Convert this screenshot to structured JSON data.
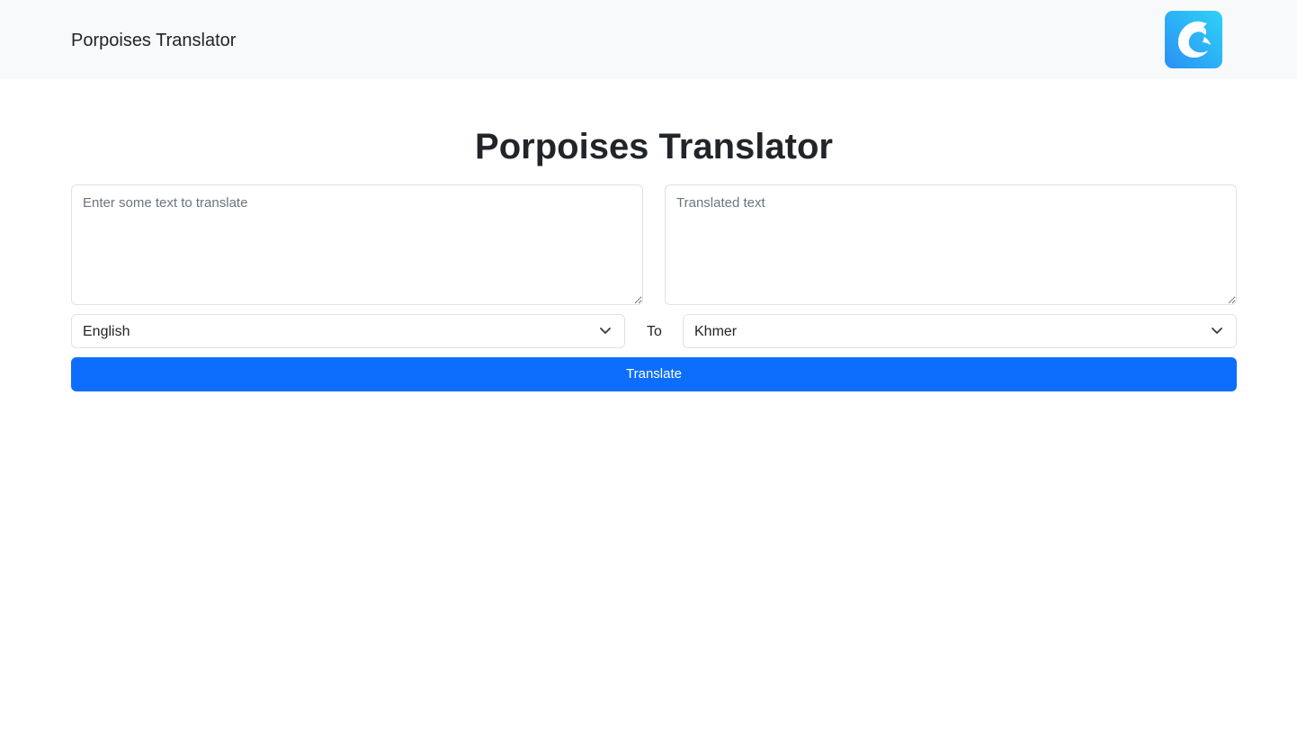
{
  "navbar": {
    "brand": "Porpoises Translator",
    "logo_icon": "dolphin-logo-icon",
    "logo_gradient": [
      "#2ed3f6",
      "#2b8ff5"
    ]
  },
  "main": {
    "title": "Porpoises Translator",
    "source_text": {
      "value": "",
      "placeholder": "Enter some text to translate"
    },
    "translated_text": {
      "value": "",
      "placeholder": "Translated text"
    },
    "source_language": "English",
    "to_label": "To",
    "target_language": "Khmer",
    "translate_button": "Translate"
  },
  "colors": {
    "navbar_bg": "#f8f9fa",
    "primary": "#0d6efd",
    "border": "#dee2e6"
  }
}
